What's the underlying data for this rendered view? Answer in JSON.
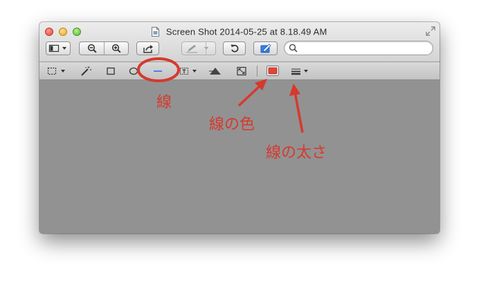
{
  "window": {
    "title": "Screen Shot 2014-05-25 at 8.18.49 AM"
  },
  "toolbar": {
    "search_value": "",
    "search_placeholder": ""
  },
  "edit_toolbar": {
    "line_color_swatch": "#e0453a"
  },
  "annotations": {
    "line_label": "線",
    "line_color_label": "線の色",
    "line_thickness_label": "線の太さ",
    "color": "#d6392e"
  }
}
